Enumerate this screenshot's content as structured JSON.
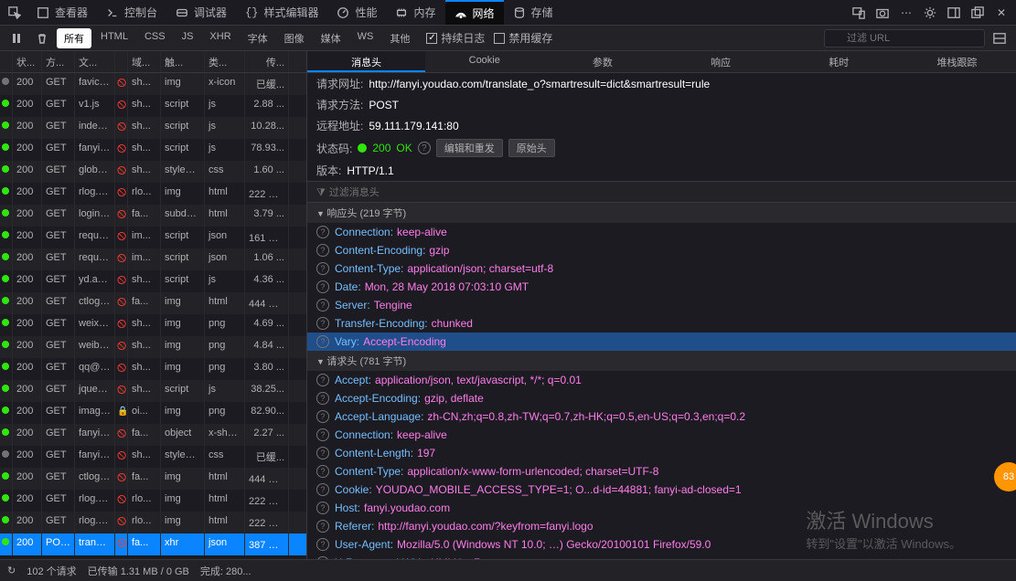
{
  "top_tabs": {
    "items": [
      {
        "label": "查看器",
        "icon": "inspector"
      },
      {
        "label": "控制台",
        "icon": "console"
      },
      {
        "label": "调试器",
        "icon": "debugger"
      },
      {
        "label": "样式编辑器",
        "icon": "style"
      },
      {
        "label": "性能",
        "icon": "perf"
      },
      {
        "label": "内存",
        "icon": "memory"
      },
      {
        "label": "网络",
        "icon": "network",
        "active": true
      },
      {
        "label": "存储",
        "icon": "storage"
      }
    ]
  },
  "toolbar": {
    "filters": [
      "所有",
      "HTML",
      "CSS",
      "JS",
      "XHR",
      "字体",
      "图像",
      "媒体",
      "WS",
      "其他"
    ],
    "active_filter": "所有",
    "persist_logs_label": "持续日志",
    "persist_logs_checked": true,
    "disable_cache_label": "禁用缓存",
    "disable_cache_checked": false,
    "filter_placeholder": "过滤 URL"
  },
  "req_columns": [
    "状...",
    "方...",
    "文...",
    "域...",
    "触...",
    "类...",
    "传..."
  ],
  "requests": [
    {
      "st": "grey",
      "status": "200",
      "method": "GET",
      "file": "favico...",
      "sec": "no",
      "domain": "sh...",
      "cause": "img",
      "type": "x-icon",
      "size": "已缓..."
    },
    {
      "st": "green",
      "status": "200",
      "method": "GET",
      "file": "v1.js",
      "sec": "no",
      "domain": "sh...",
      "cause": "script",
      "type": "js",
      "size": "2.88 ..."
    },
    {
      "st": "green",
      "status": "200",
      "method": "GET",
      "file": "index....",
      "sec": "no",
      "domain": "sh...",
      "cause": "script",
      "type": "js",
      "size": "10.28..."
    },
    {
      "st": "green",
      "status": "200",
      "method": "GET",
      "file": "fanyi....",
      "sec": "no",
      "domain": "sh...",
      "cause": "script",
      "type": "js",
      "size": "78.93..."
    },
    {
      "st": "green",
      "status": "200",
      "method": "GET",
      "file": "global...",
      "sec": "no",
      "domain": "sh...",
      "cause": "stylesh...",
      "type": "css",
      "size": "1.60 ..."
    },
    {
      "st": "green",
      "status": "200",
      "method": "GET",
      "file": "rlog.p...",
      "sec": "no",
      "domain": "rlo...",
      "cause": "img",
      "type": "html",
      "size": "222 字..."
    },
    {
      "st": "green",
      "status": "200",
      "method": "GET",
      "file": "login?...",
      "sec": "no",
      "domain": "fa...",
      "cause": "subdo...",
      "type": "html",
      "size": "3.79 ..."
    },
    {
      "st": "green",
      "status": "200",
      "method": "GET",
      "file": "reques...",
      "sec": "no",
      "domain": "im...",
      "cause": "script",
      "type": "json",
      "size": "161 字..."
    },
    {
      "st": "green",
      "status": "200",
      "method": "GET",
      "file": "reques...",
      "sec": "no",
      "domain": "im...",
      "cause": "script",
      "type": "json",
      "size": "1.06 ..."
    },
    {
      "st": "green",
      "status": "200",
      "method": "GET",
      "file": "yd.acc...",
      "sec": "no",
      "domain": "sh...",
      "cause": "script",
      "type": "js",
      "size": "4.36 ..."
    },
    {
      "st": "green",
      "status": "200",
      "method": "GET",
      "file": "ctlog?...",
      "sec": "no",
      "domain": "fa...",
      "cause": "img",
      "type": "html",
      "size": "444 字..."
    },
    {
      "st": "green",
      "status": "200",
      "method": "GET",
      "file": "weixin...",
      "sec": "no",
      "domain": "sh...",
      "cause": "img",
      "type": "png",
      "size": "4.69 ..."
    },
    {
      "st": "green",
      "status": "200",
      "method": "GET",
      "file": "weibo...",
      "sec": "no",
      "domain": "sh...",
      "cause": "img",
      "type": "png",
      "size": "4.84 ..."
    },
    {
      "st": "green",
      "status": "200",
      "method": "GET",
      "file": "qq@2...",
      "sec": "no",
      "domain": "sh...",
      "cause": "img",
      "type": "png",
      "size": "3.80 ..."
    },
    {
      "st": "green",
      "status": "200",
      "method": "GET",
      "file": "jquery...",
      "sec": "no",
      "domain": "sh...",
      "cause": "script",
      "type": "js",
      "size": "38.25..."
    },
    {
      "st": "green",
      "status": "200",
      "method": "GET",
      "file": "image...",
      "sec": "yes",
      "domain": "oi...",
      "cause": "img",
      "type": "png",
      "size": "82.90..."
    },
    {
      "st": "green",
      "status": "200",
      "method": "GET",
      "file": "fanyi.v...",
      "sec": "no",
      "domain": "fa...",
      "cause": "object",
      "type": "x-shoc...",
      "size": "2.27 ..."
    },
    {
      "st": "grey",
      "status": "200",
      "method": "GET",
      "file": "fanyi-...",
      "sec": "no",
      "domain": "sh...",
      "cause": "stylesh...",
      "type": "css",
      "size": "已缓..."
    },
    {
      "st": "green",
      "status": "200",
      "method": "GET",
      "file": "ctlog?...",
      "sec": "no",
      "domain": "fa...",
      "cause": "img",
      "type": "html",
      "size": "444 字..."
    },
    {
      "st": "green",
      "status": "200",
      "method": "GET",
      "file": "rlog.p...",
      "sec": "no",
      "domain": "rlo...",
      "cause": "img",
      "type": "html",
      "size": "222 字..."
    },
    {
      "st": "green",
      "status": "200",
      "method": "GET",
      "file": "rlog.p...",
      "sec": "no",
      "domain": "rlo...",
      "cause": "img",
      "type": "html",
      "size": "222 字..."
    },
    {
      "st": "green",
      "status": "200",
      "method": "POST",
      "file": "transla...",
      "sec": "no",
      "domain": "fa...",
      "cause": "xhr",
      "type": "json",
      "size": "387 字...",
      "selected": true
    }
  ],
  "detail_tabs": [
    "消息头",
    "Cookie",
    "参数",
    "响应",
    "耗时",
    "堆栈跟踪"
  ],
  "detail_active_tab": "消息头",
  "summary": {
    "url_label": "请求网址:",
    "url": "http://fanyi.youdao.com/translate_o?smartresult=dict&smartresult=rule",
    "method_label": "请求方法:",
    "method": "POST",
    "remote_label": "远程地址:",
    "remote": "59.111.179.141:80",
    "status_label": "状态码:",
    "status": "200",
    "status_text": "OK",
    "edit_resend": "编辑和重发",
    "raw_headers": "原始头",
    "version_label": "版本:",
    "version": "HTTP/1.1",
    "filter_headers_placeholder": "过滤消息头"
  },
  "response_headers": {
    "title": "响应头 (219 字节)",
    "items": [
      {
        "name": "Connection",
        "value": "keep-alive"
      },
      {
        "name": "Content-Encoding",
        "value": "gzip"
      },
      {
        "name": "Content-Type",
        "value": "application/json; charset=utf-8"
      },
      {
        "name": "Date",
        "value": "Mon, 28 May 2018 07:03:10 GMT"
      },
      {
        "name": "Server",
        "value": "Tengine"
      },
      {
        "name": "Transfer-Encoding",
        "value": "chunked"
      },
      {
        "name": "Vary",
        "value": "Accept-Encoding",
        "selected": true
      }
    ]
  },
  "request_headers": {
    "title": "请求头 (781 字节)",
    "items": [
      {
        "name": "Accept",
        "value": "application/json, text/javascript, */*; q=0.01"
      },
      {
        "name": "Accept-Encoding",
        "value": "gzip, deflate"
      },
      {
        "name": "Accept-Language",
        "value": "zh-CN,zh;q=0.8,zh-TW;q=0.7,zh-HK;q=0.5,en-US;q=0.3,en;q=0.2"
      },
      {
        "name": "Connection",
        "value": "keep-alive"
      },
      {
        "name": "Content-Length",
        "value": "197"
      },
      {
        "name": "Content-Type",
        "value": "application/x-www-form-urlencoded; charset=UTF-8"
      },
      {
        "name": "Cookie",
        "value": "YOUDAO_MOBILE_ACCESS_TYPE=1; O...d-id=44881; fanyi-ad-closed=1"
      },
      {
        "name": "Host",
        "value": "fanyi.youdao.com"
      },
      {
        "name": "Referer",
        "value": "http://fanyi.youdao.com/?keyfrom=fanyi.logo"
      },
      {
        "name": "User-Agent",
        "value": "Mozilla/5.0 (Windows NT 10.0; …) Gecko/20100101 Firefox/59.0"
      },
      {
        "name": "X-Requested-With",
        "value": "XMLHttpRequest"
      }
    ]
  },
  "status_bar": {
    "requests": "102 个请求",
    "transferred": "已传输 1.31 MB / 0 GB",
    "finish": "完成: 280..."
  },
  "watermark": {
    "title": "激活 Windows",
    "sub": "转到\"设置\"以激活 Windows。"
  },
  "badge": "83"
}
